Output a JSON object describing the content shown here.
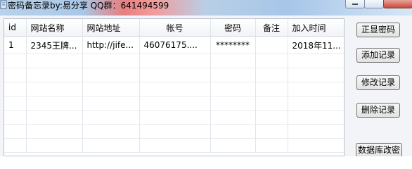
{
  "window": {
    "title": "密码备忘录by:易分享 QQ群：641494599"
  },
  "table": {
    "headers": [
      "id",
      "网站名称",
      "网站地址",
      "帐号",
      "密码",
      "备注",
      "加入时间"
    ],
    "rows": [
      [
        "1",
        "2345王牌...",
        "http://jife...",
        "46076175....",
        "********",
        "",
        "2018年11..."
      ]
    ]
  },
  "buttons": {
    "show_password": "正显密码",
    "add_record": "添加记录",
    "edit_record": "修改记录",
    "delete_record": "删除记录",
    "db_change": "数据库改密"
  }
}
